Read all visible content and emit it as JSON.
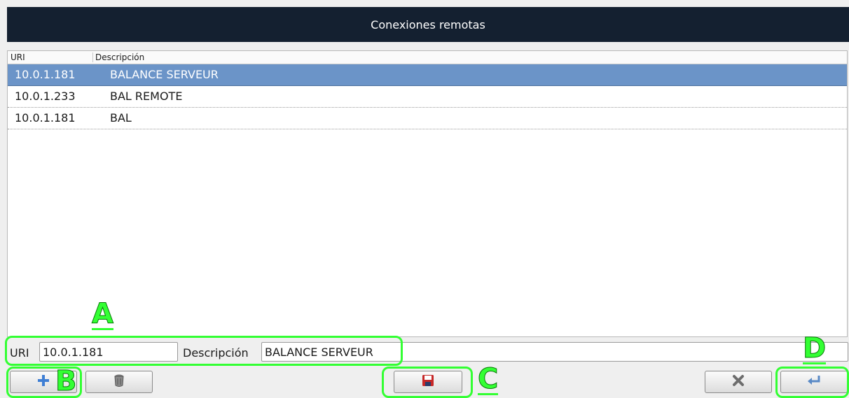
{
  "window": {
    "title": "Conexiones remotas"
  },
  "list": {
    "columns": [
      "URI",
      "Descripción"
    ],
    "rows": [
      {
        "uri": "10.0.1.181",
        "description": "BALANCE SERVEUR",
        "selected": true
      },
      {
        "uri": "10.0.1.233",
        "description": "BAL REMOTE",
        "selected": false
      },
      {
        "uri": "10.0.1.181",
        "description": "BAL",
        "selected": false
      }
    ]
  },
  "editor": {
    "uri_label": "URI",
    "uri_value": "10.0.1.181",
    "description_label": "Descripción",
    "description_value": "BALANCE SERVEUR"
  },
  "buttons": {
    "add_icon": "plus-icon",
    "delete_icon": "trash-icon",
    "save_icon": "floppy-disk-icon",
    "cancel_icon": "x-icon",
    "return_icon": "enter-icon"
  },
  "annotations": {
    "a": "A",
    "b": "B",
    "c": "C",
    "d": "D"
  },
  "colors": {
    "title_bg": "#142030",
    "selection": "#6b94c8",
    "highlight": "#33ff33",
    "add_icon": "#3f7fd4",
    "save_icon": "#c62828"
  }
}
